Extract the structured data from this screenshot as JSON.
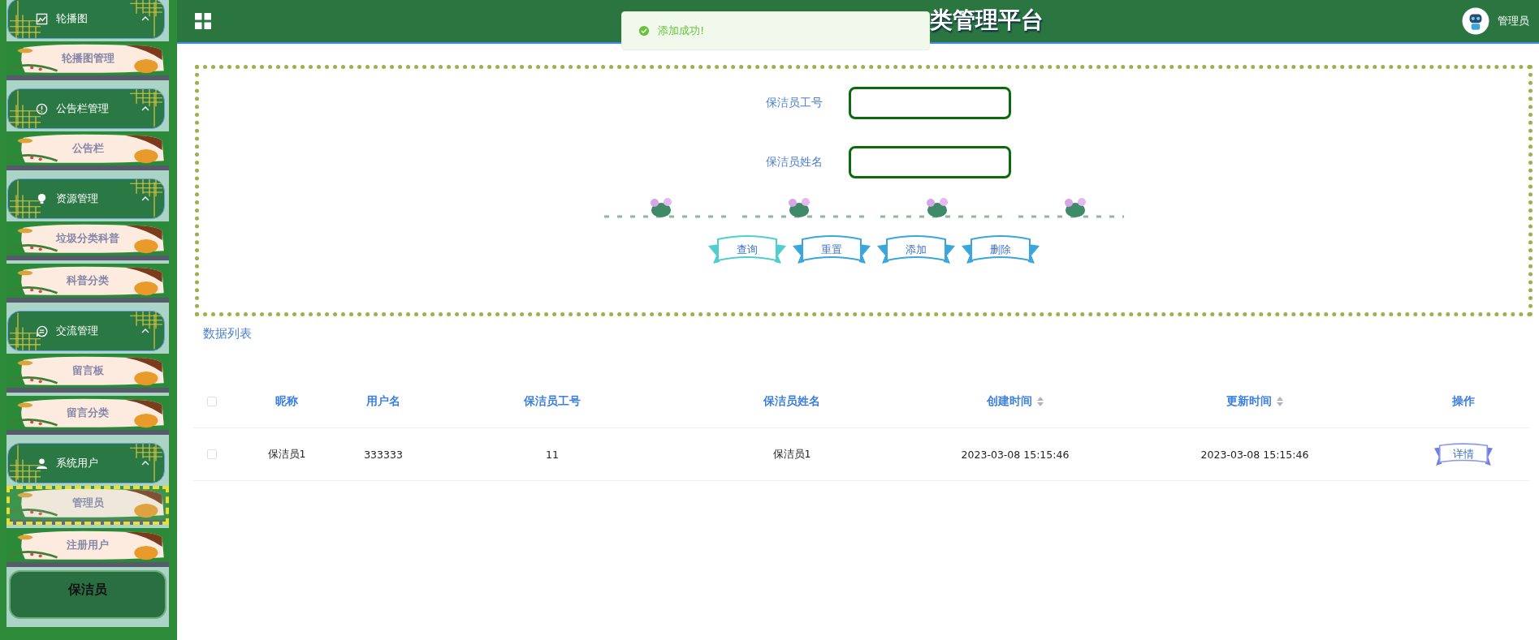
{
  "header": {
    "title": "类管理平台",
    "user": "管理员"
  },
  "toast": {
    "message": "添加成功!"
  },
  "sidebar": {
    "groups": [
      {
        "label": "轮播图",
        "kind": "image",
        "expanded": true,
        "children": [
          {
            "label": "轮播图管理",
            "selected": false
          }
        ]
      },
      {
        "label": "公告栏管理",
        "kind": "alert",
        "expanded": true,
        "children": [
          {
            "label": "公告栏",
            "selected": false
          }
        ]
      },
      {
        "label": "资源管理",
        "kind": "bulb",
        "expanded": true,
        "children": [
          {
            "label": "垃圾分类科普",
            "selected": false
          },
          {
            "label": "科普分类",
            "selected": false
          }
        ]
      },
      {
        "label": "交流管理",
        "kind": "chat",
        "expanded": true,
        "children": [
          {
            "label": "留言板",
            "selected": false
          },
          {
            "label": "留言分类",
            "selected": false
          }
        ]
      },
      {
        "label": "系统用户",
        "kind": "user",
        "expanded": true,
        "children": [
          {
            "label": "管理员",
            "selected": true
          },
          {
            "label": "注册用户",
            "selected": false
          }
        ]
      }
    ],
    "bottom_label": "保洁员"
  },
  "form": {
    "fields": [
      {
        "label": "保洁员工号"
      },
      {
        "label": "保洁员姓名"
      }
    ],
    "buttons": [
      {
        "label": "查询",
        "color": "#4fcfd0"
      },
      {
        "label": "重置",
        "color": "#3aa6dc"
      },
      {
        "label": "添加",
        "color": "#3aa6dc"
      },
      {
        "label": "删除",
        "color": "#3aa6dc"
      }
    ]
  },
  "table": {
    "title": "数据列表",
    "header_checked": false,
    "columns": [
      {
        "label": "昵称",
        "sortable": false
      },
      {
        "label": "用户名",
        "sortable": false
      },
      {
        "label": "保洁员工号",
        "sortable": false
      },
      {
        "label": "保洁员姓名",
        "sortable": false
      },
      {
        "label": "创建时间",
        "sortable": true
      },
      {
        "label": "更新时间",
        "sortable": true
      },
      {
        "label": "操作",
        "sortable": false
      }
    ],
    "rows": [
      {
        "checked": false,
        "cells": [
          "保洁员1",
          "333333",
          "11",
          "保洁员1",
          "2023-03-08 15:15:46",
          "2023-03-08 15:15:46"
        ],
        "action": "详情"
      }
    ]
  }
}
